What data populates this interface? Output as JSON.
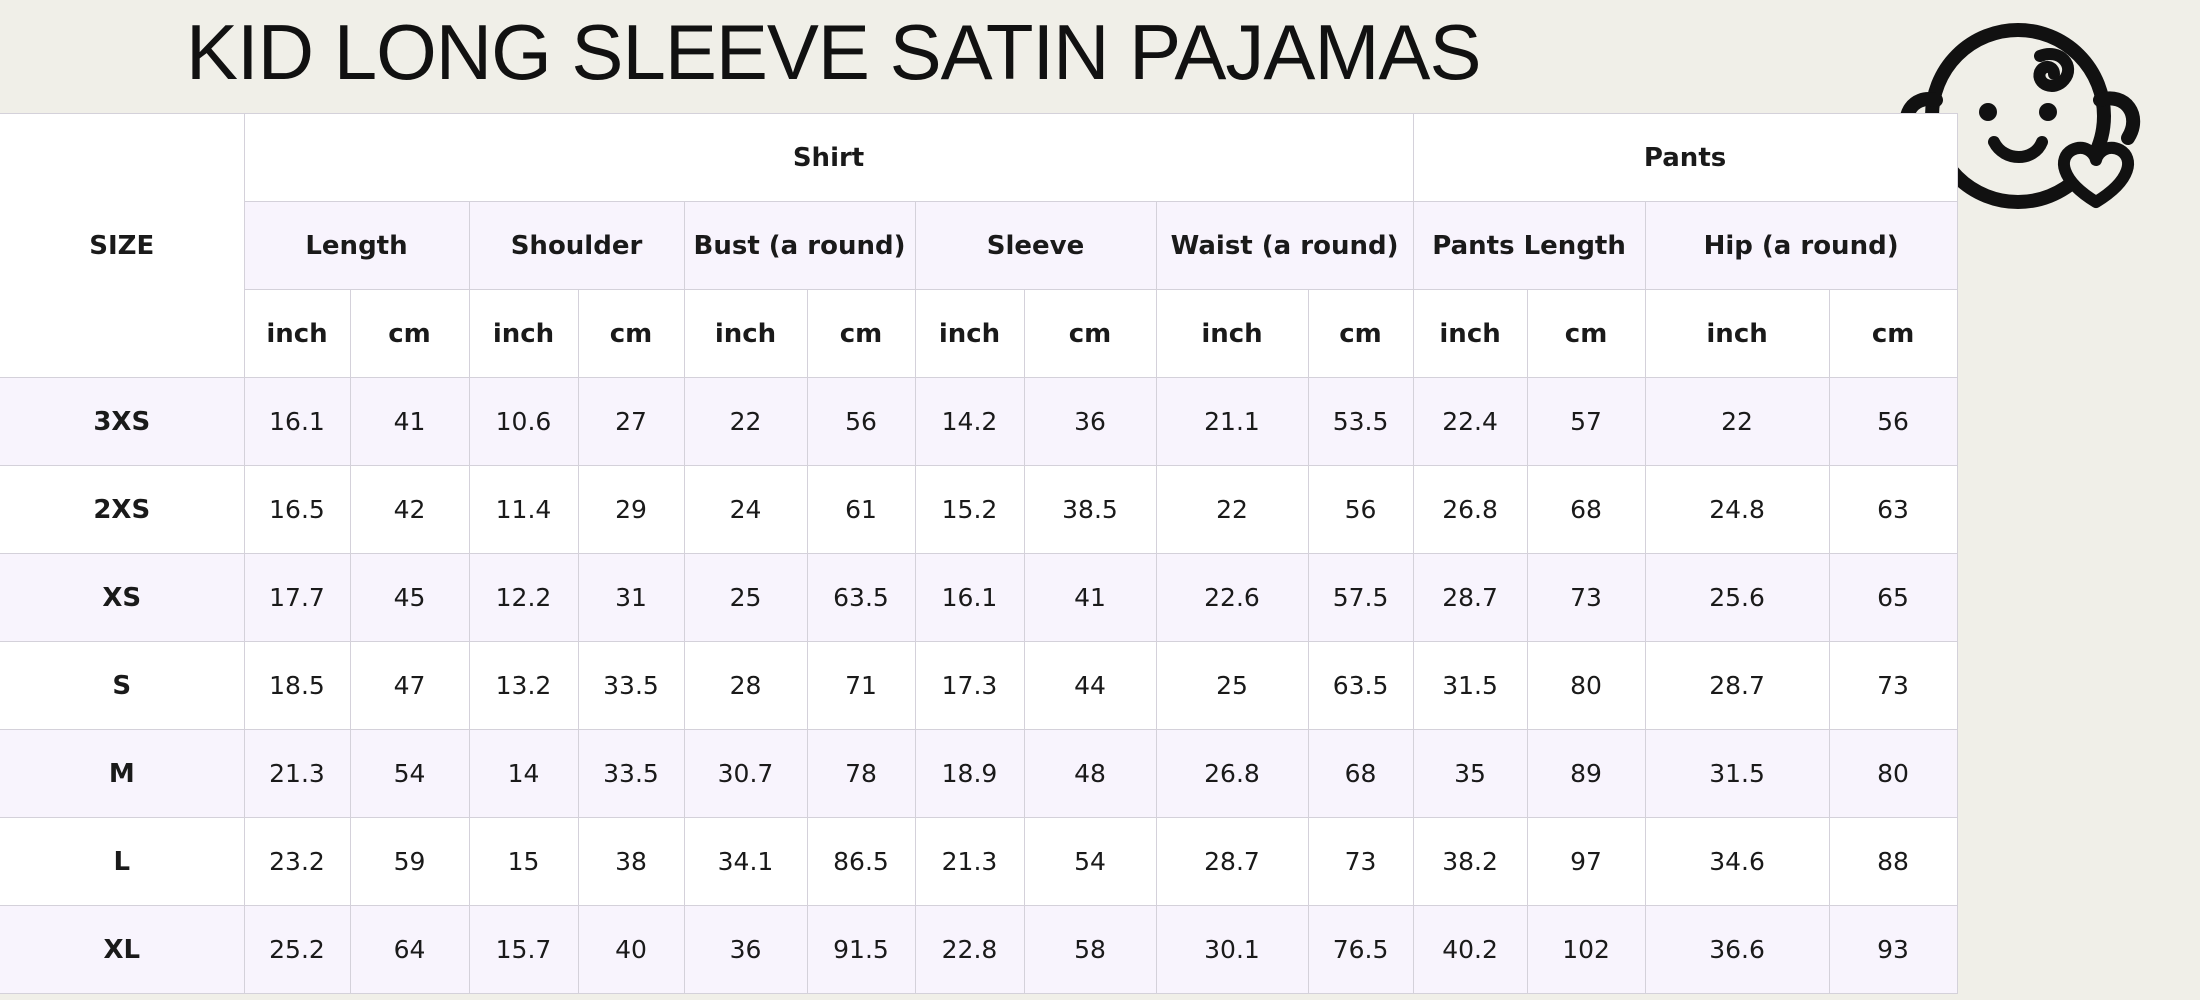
{
  "title": "KID LONG SLEEVE SATIN PAJAMAS",
  "icons": {
    "logo": "baby-face-heart-icon"
  },
  "table": {
    "size_label": "SIZE",
    "groups": [
      "Shirt",
      "Pants"
    ],
    "measures": [
      "Length",
      "Shoulder",
      "Bust (a round)",
      "Sleeve",
      "Waist (a round)",
      "Pants Length",
      "Hip (a round)"
    ],
    "units": [
      "inch",
      "cm",
      "inch",
      "cm",
      "inch",
      "cm",
      "inch",
      "cm",
      "inch",
      "cm",
      "inch",
      "cm",
      "inch",
      "cm"
    ],
    "rows": [
      {
        "size": "3XS",
        "values": [
          "16.1",
          "41",
          "10.6",
          "27",
          "22",
          "56",
          "14.2",
          "36",
          "21.1",
          "53.5",
          "22.4",
          "57",
          "22",
          "56"
        ]
      },
      {
        "size": "2XS",
        "values": [
          "16.5",
          "42",
          "11.4",
          "29",
          "24",
          "61",
          "15.2",
          "38.5",
          "22",
          "56",
          "26.8",
          "68",
          "24.8",
          "63"
        ]
      },
      {
        "size": "XS",
        "values": [
          "17.7",
          "45",
          "12.2",
          "31",
          "25",
          "63.5",
          "16.1",
          "41",
          "22.6",
          "57.5",
          "28.7",
          "73",
          "25.6",
          "65"
        ]
      },
      {
        "size": "S",
        "values": [
          "18.5",
          "47",
          "13.2",
          "33.5",
          "28",
          "71",
          "17.3",
          "44",
          "25",
          "63.5",
          "31.5",
          "80",
          "28.7",
          "73"
        ]
      },
      {
        "size": "M",
        "values": [
          "21.3",
          "54",
          "14",
          "33.5",
          "30.7",
          "78",
          "18.9",
          "48",
          "26.8",
          "68",
          "35",
          "89",
          "31.5",
          "80"
        ]
      },
      {
        "size": "L",
        "values": [
          "23.2",
          "59",
          "15",
          "38",
          "34.1",
          "86.5",
          "21.3",
          "54",
          "28.7",
          "73",
          "38.2",
          "97",
          "34.6",
          "88"
        ]
      },
      {
        "size": "XL",
        "values": [
          "25.2",
          "64",
          "15.7",
          "40",
          "36",
          "91.5",
          "22.8",
          "58",
          "30.1",
          "76.5",
          "40.2",
          "102",
          "36.6",
          "93"
        ]
      }
    ]
  }
}
